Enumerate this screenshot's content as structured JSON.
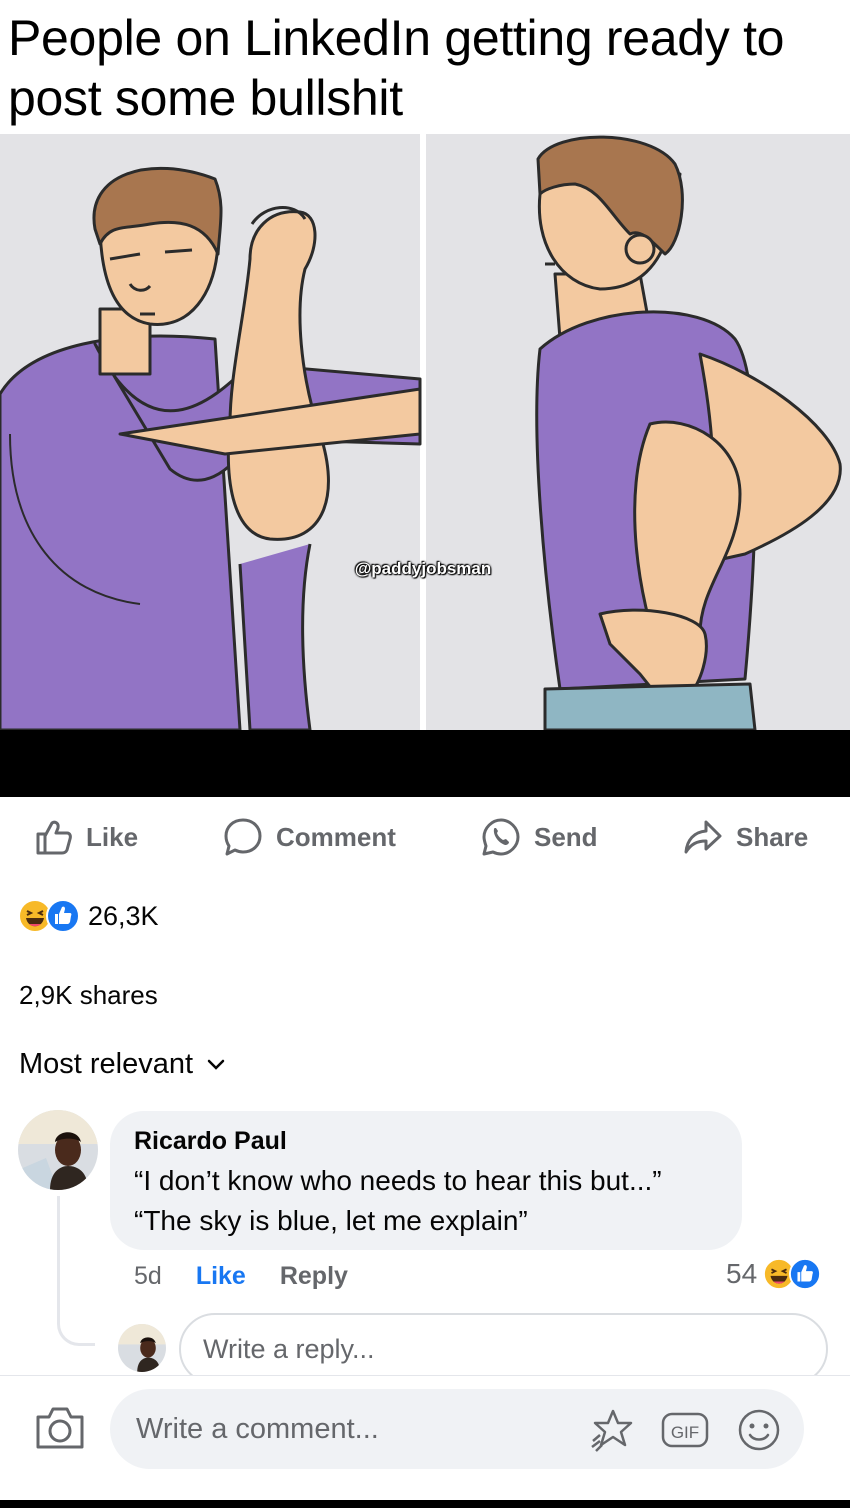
{
  "post": {
    "caption": "People on LinkedIn getting ready to post some bullshit",
    "watermark": "@paddyjobsman"
  },
  "actions": {
    "like": "Like",
    "comment": "Comment",
    "send": "Send",
    "share": "Share"
  },
  "stats": {
    "reaction_count": "26,3K",
    "shares": "2,9K shares"
  },
  "comments": {
    "sort_label": "Most relevant",
    "items": [
      {
        "author": "Ricardo Paul",
        "line1": "“I don’t know who needs to hear this but...”",
        "line2": "“The sky is blue, let me explain”",
        "time": "5d",
        "like_label": "Like",
        "reply_label": "Reply",
        "reaction_count": "54"
      }
    ],
    "reply_placeholder": "Write a reply...",
    "comment_placeholder": "Write a comment..."
  },
  "icons": {
    "like": "thumbs-up-icon",
    "comment": "speech-bubble-icon",
    "send": "whatsapp-icon",
    "share": "share-arrow-icon",
    "haha": "haha-reaction-icon",
    "like_reaction": "like-reaction-icon",
    "chevron": "chevron-down-icon",
    "camera": "camera-icon",
    "sticker": "sticker-icon",
    "gif": "gif-icon",
    "emoji": "emoji-icon"
  },
  "colors": {
    "accent": "#1877f2",
    "muted_text": "#65676b",
    "bubble": "#f0f2f5",
    "shirt": "#9274c5",
    "skin": "#f3c9a0",
    "hair": "#a8764f",
    "pants": "#8fb6c3"
  }
}
